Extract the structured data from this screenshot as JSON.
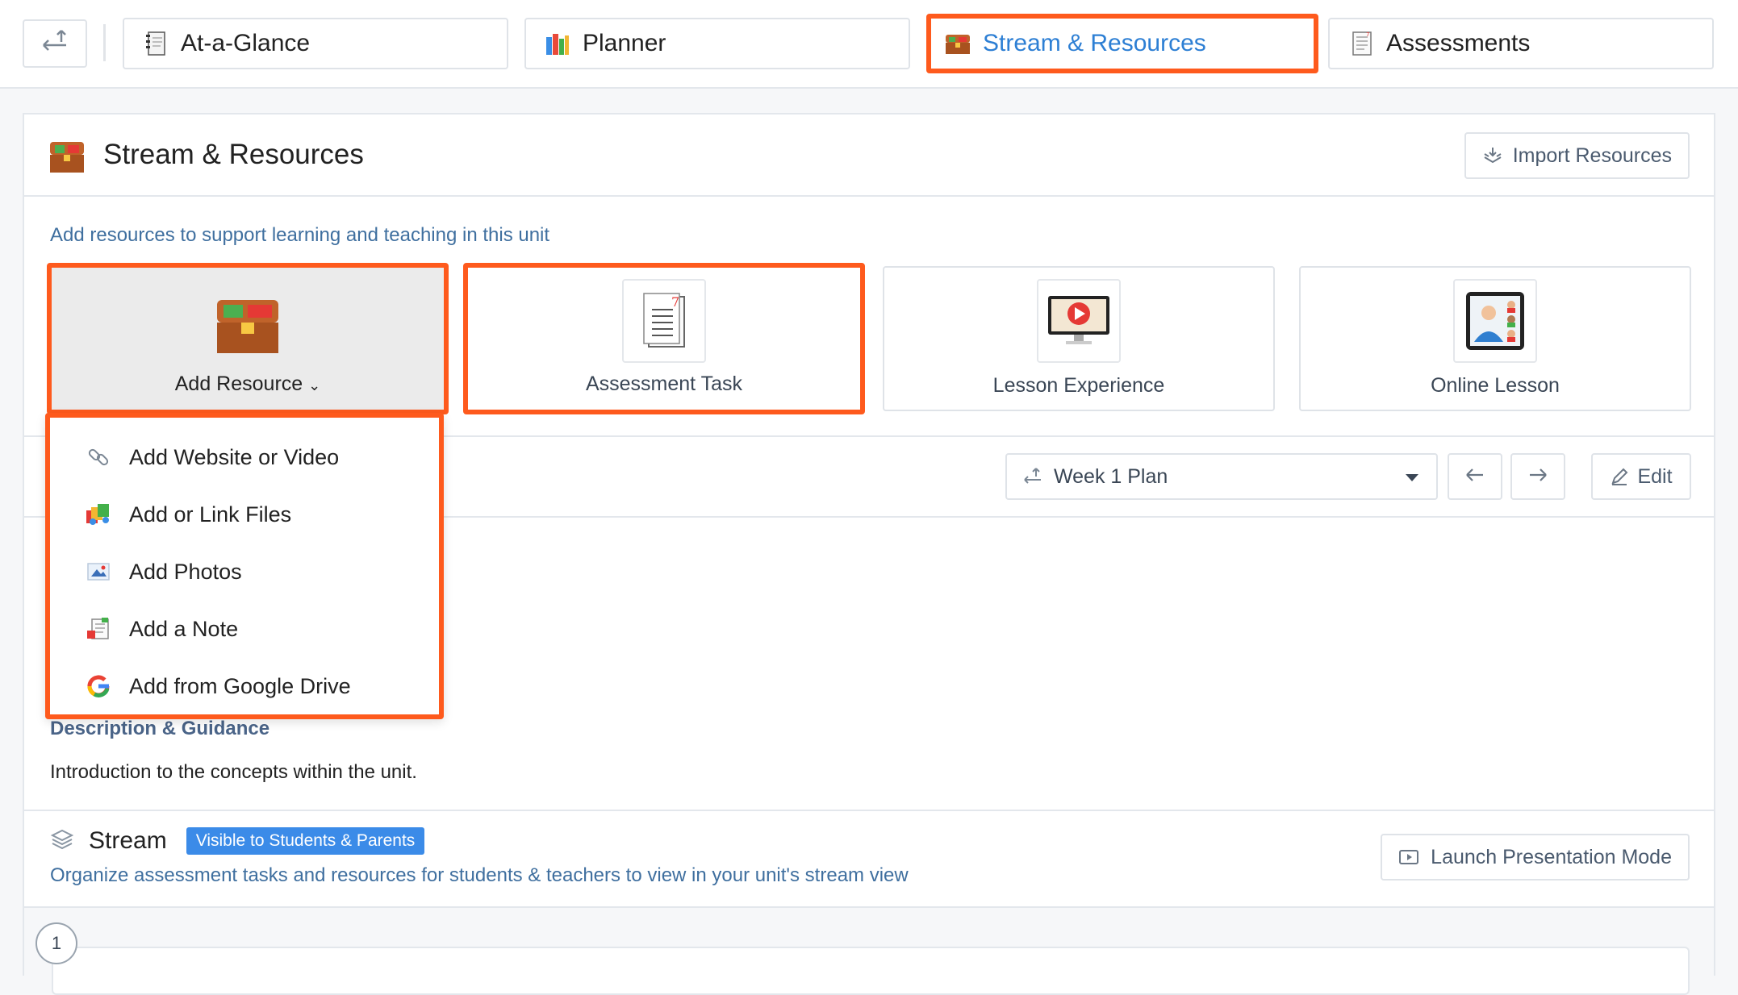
{
  "tabs": [
    {
      "label": "At-a-Glance",
      "icon": "notebook-icon"
    },
    {
      "label": "Planner",
      "icon": "books-icon"
    },
    {
      "label": "Stream & Resources",
      "icon": "treasure-chest-icon",
      "active": true
    },
    {
      "label": "Assessments",
      "icon": "document-icon"
    }
  ],
  "header": {
    "title": "Stream & Resources",
    "import_label": "Import Resources"
  },
  "resources": {
    "subtitle": "Add resources to support learning and teaching in this unit",
    "tiles": [
      {
        "label": "Add Resource",
        "icon": "treasure-chest-icon"
      },
      {
        "label": "Assessment Task",
        "icon": "assessment-document-icon"
      },
      {
        "label": "Lesson Experience",
        "icon": "video-monitor-icon"
      },
      {
        "label": "Online Lesson",
        "icon": "video-call-icon"
      }
    ]
  },
  "dropdown": {
    "items": [
      {
        "label": "Add Website or Video",
        "icon": "link-icon"
      },
      {
        "label": "Add or Link Files",
        "icon": "files-icon"
      },
      {
        "label": "Add Photos",
        "icon": "photo-icon"
      },
      {
        "label": "Add a Note",
        "icon": "note-icon"
      },
      {
        "label": "Add from Google Drive",
        "icon": "google-drive-icon"
      }
    ]
  },
  "week": {
    "selected": "Week 1 Plan",
    "edit_label": "Edit"
  },
  "description": {
    "heading": "Description & Guidance",
    "text": "Introduction to the concepts within the unit."
  },
  "stream": {
    "title": "Stream",
    "badge": "Visible to Students & Parents",
    "description": "Organize assessment tasks and resources for students & teachers to view in your unit's stream view",
    "launch_label": "Launch Presentation Mode",
    "step_number": "1"
  },
  "colors": {
    "highlight": "#fe5a1d",
    "accent": "#2d7fd4",
    "badge": "#3b8be8"
  }
}
